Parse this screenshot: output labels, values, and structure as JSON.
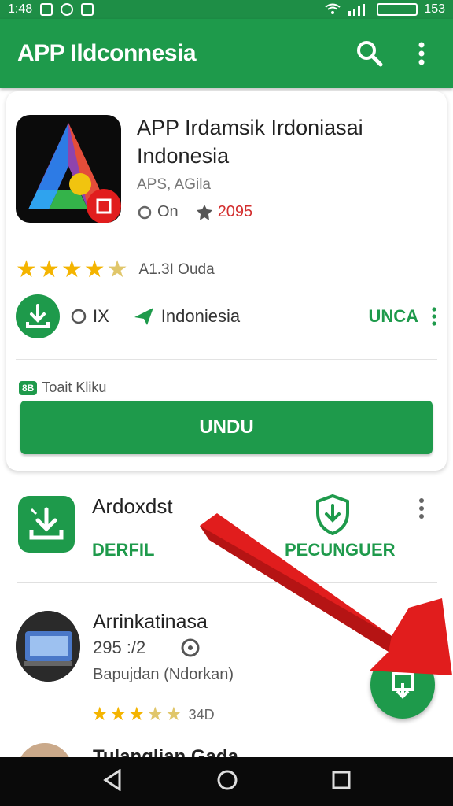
{
  "status_bar": {
    "time": "1:48",
    "right_time": "153",
    "battery": ""
  },
  "app_bar": {
    "title": "APP Ildconnesia"
  },
  "app": {
    "name_line1": "APP Irdamsik Irdoniasai",
    "name_line2": "Indonesia",
    "developer": "APS, AGila",
    "meta_on": "On",
    "meta_year": "2095",
    "rating_text": "A1.3I Ouda",
    "size": "IX",
    "region": "Indoniesia",
    "action_label": "UNCA",
    "tag_text": "Toait Kliku",
    "tag_badge": "8B",
    "install_label": "UNDU"
  },
  "list": {
    "item1": {
      "title": "Ardoxdst",
      "label_left": "DERFIL",
      "label_right": "PECUNGUER"
    },
    "item2": {
      "title": "Arrinkatinasa",
      "sub": "295 :/2",
      "desc": "Bapujdan (Ndorkan)",
      "count": "34D"
    },
    "item3": {
      "title": "Tulanglian Gada"
    }
  },
  "colors": {
    "primary": "#1e9a4b",
    "accent_red": "#e11d1d",
    "star": "#f4b400"
  }
}
